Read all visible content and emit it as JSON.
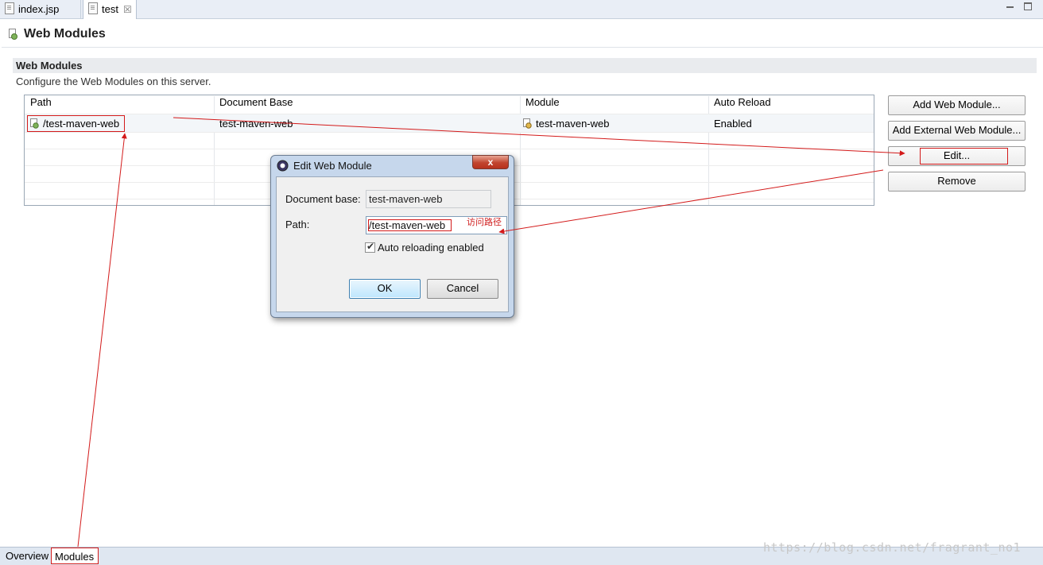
{
  "editor_tabs": [
    {
      "label": "index.jsp",
      "icon": "jsp-file-icon"
    },
    {
      "label": "test",
      "icon": "server-config-icon",
      "close": "☒"
    }
  ],
  "header": {
    "title": "Web Modules",
    "icon": "web-module-icon"
  },
  "section": {
    "title": "Web Modules",
    "description": "Configure the Web Modules on this server."
  },
  "table": {
    "columns": [
      "Path",
      "Document Base",
      "Module",
      "Auto Reload"
    ],
    "rows": [
      {
        "path": "/test-maven-web",
        "document_base": "test-maven-web",
        "module": "test-maven-web",
        "auto_reload": "Enabled"
      }
    ]
  },
  "buttons": {
    "add": "Add Web Module...",
    "add_external": "Add External Web Module...",
    "edit": "Edit...",
    "remove": "Remove"
  },
  "dialog": {
    "title": "Edit Web Module",
    "close_glyph": "x",
    "document_base_label": "Document base:",
    "document_base_value": "test-maven-web",
    "path_label": "Path:",
    "path_value": "/test-maven-web",
    "auto_reload_label": "Auto reloading enabled",
    "auto_reload_checked": true,
    "check_glyph": "✔",
    "ok_label": "OK",
    "cancel_label": "Cancel",
    "annotation": "访问路径"
  },
  "bottom_tabs": [
    "Overview",
    "Modules"
  ],
  "watermark": "https://blog.csdn.net/fragrant_no1",
  "colors": {
    "annotation_red": "#d31a1a",
    "tab_bar": "#e9eef6",
    "dialog_frame": "#c6d7ec"
  }
}
